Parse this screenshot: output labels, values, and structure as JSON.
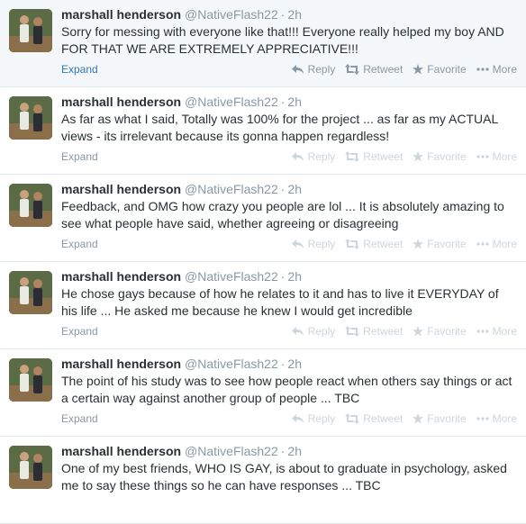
{
  "actions": {
    "expand": "Expand",
    "reply": "Reply",
    "retweet": "Retweet",
    "favorite": "Favorite",
    "more": "More"
  },
  "colors": {
    "link_blue": "#2f77b5",
    "muted": "#8899a6",
    "faded": "#ccd6dd",
    "highlight_bg": "#f5f8fa"
  },
  "tweets": [
    {
      "fullname": "marshall henderson",
      "username": "@NativeFlash22",
      "time": "2h",
      "text": "Sorry for messing with everyone like that!!!  Everyone really helped my boy AND FOR THAT WE ARE EXTREMELY APPRECIATIVE!!!"
    },
    {
      "fullname": "marshall henderson",
      "username": "@NativeFlash22",
      "time": "2h",
      "text": "As far as what I said, Totally was 100% for the project ... as far as my ACTUAL views - its irrelevant because its gonna happen regardless!"
    },
    {
      "fullname": "marshall henderson",
      "username": "@NativeFlash22",
      "time": "2h",
      "text": "Feedback, and OMG how crazy you people are lol ... It is absolutely amazing to see what people have said, whether agreeing or disagreeing"
    },
    {
      "fullname": "marshall henderson",
      "username": "@NativeFlash22",
      "time": "2h",
      "text": "He chose gays because of how he relates to it and has to live it EVERYDAY of his life ... He asked me because he knew I would get incredible"
    },
    {
      "fullname": "marshall henderson",
      "username": "@NativeFlash22",
      "time": "2h",
      "text": "The point of his study was to see how people react when others say things or act a certain way against another group of people ... TBC"
    },
    {
      "fullname": "marshall henderson",
      "username": "@NativeFlash22",
      "time": "2h",
      "text": "One of my best friends, WHO IS GAY, is about to graduate in psychology, asked me to say these things so he can have responses ... TBC"
    }
  ]
}
